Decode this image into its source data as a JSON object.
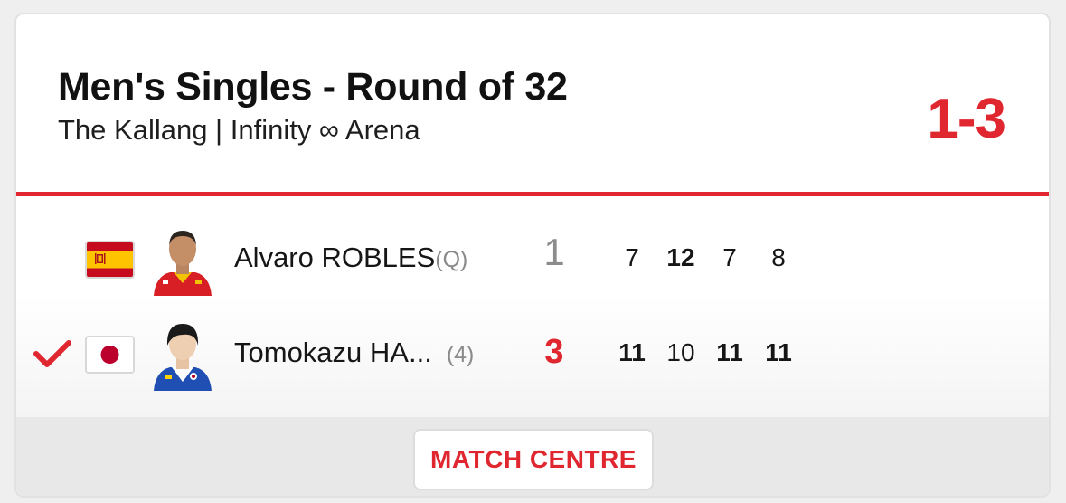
{
  "match": {
    "title": "Men's Singles - Round of 32",
    "venue": "The Kallang | Infinity ∞ Arena",
    "score": "1-3"
  },
  "players": [
    {
      "name": "Alvaro ROBLES",
      "seed": "(Q)",
      "country_flag": "spain-flag-icon",
      "sets_won": "1",
      "winner": false,
      "games": [
        "7",
        "12",
        "7",
        "8"
      ]
    },
    {
      "name": "Tomokazu HA...",
      "seed": "(4)",
      "country_flag": "japan-flag-icon",
      "sets_won": "3",
      "winner": true,
      "games": [
        "11",
        "10",
        "11",
        "11"
      ]
    }
  ],
  "footer": {
    "button_label": "MATCH CENTRE"
  },
  "colors": {
    "accent": "#e0262f",
    "divider": "#e0262f",
    "muted": "#8a8a8a"
  }
}
